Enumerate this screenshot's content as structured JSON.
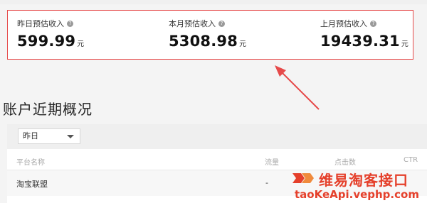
{
  "stats": [
    {
      "label": "昨日预估收入",
      "value": "599.99",
      "unit": "元"
    },
    {
      "label": "本月预估收入",
      "value": "5308.98",
      "unit": "元"
    },
    {
      "label": "上月预估收入",
      "value": "19439.31",
      "unit": "元"
    }
  ],
  "help_icon": "question-circle-icon",
  "section": {
    "title": "账户近期概况"
  },
  "filter": {
    "selected": "昨日"
  },
  "table": {
    "headers": [
      "平台名称",
      "流量",
      "点击数",
      "CTR"
    ],
    "rows": [
      [
        "淘宝联盟",
        "-"
      ]
    ]
  },
  "watermark": {
    "title": "维易淘客接口",
    "url": "taoKeApi.vephp.com"
  },
  "colors": {
    "highlight": "#e64a4a",
    "brand": "#e5402b"
  }
}
